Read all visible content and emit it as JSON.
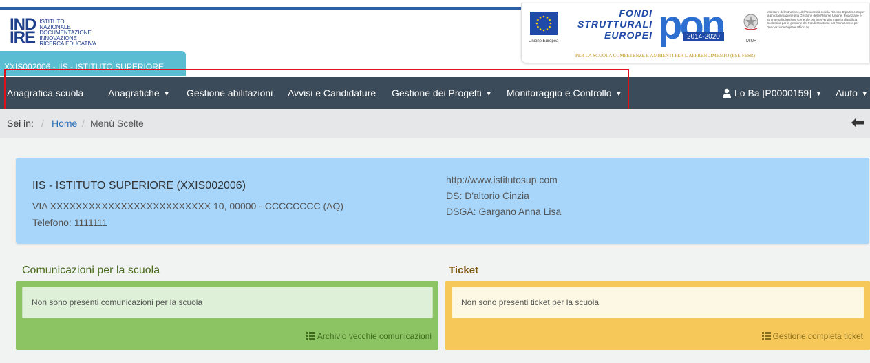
{
  "header": {
    "logo_big": "IND\nIRE",
    "logo_lines": [
      "Istituto",
      "Nazionale",
      "Documentazione",
      "Innovazione",
      "Ricerca Educativa"
    ],
    "school_tab": "XXIS002006 - IIS - ISTITUTO SUPERIORE"
  },
  "banner": {
    "eu_label": "Unione Europea",
    "fondi": "FONDI\nSTRUTTURALI\nEUROPEI",
    "pon": "pon",
    "years": "2014-2020",
    "miur": "MIUR",
    "ministry_text": "Ministero dell'Istruzione, dell'Università e della Ricerca Dipartimento per la programmazione e la Gestione delle Risorse Umane, Finanziarie e Strumentali Direzione Generale per interventi in materia di Edilizia Scolastica per la gestione dei Fondi Strutturali per l'Istruzione e per l'Innovazione Digitale Ufficio IV",
    "subtitle": "PER LA SCUOLA COMPETENZE E AMBIENTI PER L'APPRENDIMENTO (FSE-FESR)"
  },
  "nav": {
    "items": [
      {
        "label": "Anagrafica scuola",
        "dropdown": false
      },
      {
        "label": "Anagrafiche",
        "dropdown": true
      },
      {
        "label": "Gestione abilitazioni",
        "dropdown": false
      },
      {
        "label": "Avvisi e Candidature",
        "dropdown": false
      },
      {
        "label": "Gestione dei Progetti",
        "dropdown": true
      },
      {
        "label": "Monitoraggio e Controllo",
        "dropdown": true
      }
    ],
    "user": "Lo Ba [P0000159]",
    "help": "Aiuto"
  },
  "breadcrumb": {
    "prefix": "Sei in:",
    "separator": "/",
    "home": "Home",
    "current": "Menù Scelte"
  },
  "school": {
    "name": "IIS - ISTITUTO SUPERIORE (XXIS002006)",
    "address": "VIA XXXXXXXXXXXXXXXXXXXXXXXXX 10, 00000 - CCCCCCCC (AQ)",
    "phone": "Telefono: 1111111",
    "website": "http://www.istitutosup.com",
    "ds": "DS: D'altorio Cinzia",
    "dsga": "DSGA: Gargano Anna Lisa"
  },
  "communications": {
    "title": "Comunicazioni per la scuola",
    "empty": "Non sono presenti comunicazioni per la scuola",
    "link": "Archivio vecchie comunicazioni"
  },
  "ticket": {
    "title": "Ticket",
    "empty": "Non sono presenti ticket per la scuola",
    "link": "Gestione completa ticket"
  },
  "colors": {
    "navbar": "#3c4b59",
    "info_panel": "#a8d6fb",
    "green_panel": "#8cc464",
    "yellow_panel": "#f6c85a",
    "highlight": "#e0101a"
  }
}
